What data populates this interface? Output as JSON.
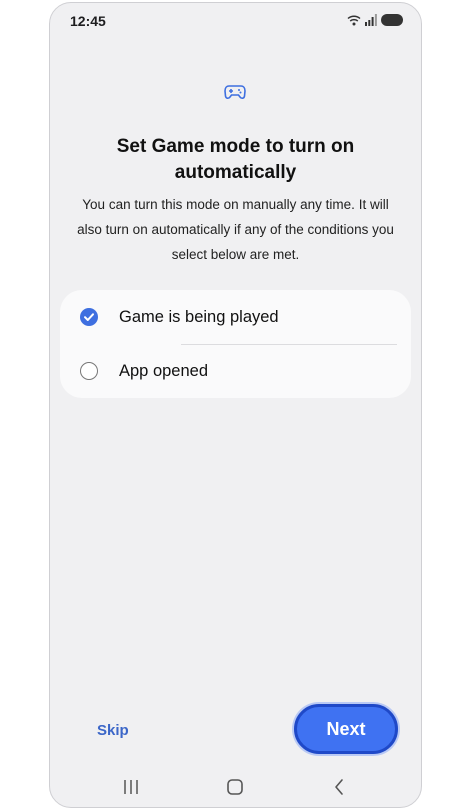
{
  "status_bar": {
    "time": "12:45"
  },
  "icons": {
    "game": "gamepad-icon",
    "wifi": "wifi-icon",
    "signal": "signal-icon",
    "battery": "battery-icon"
  },
  "header": {
    "title": "Set Game mode to turn on automatically",
    "description": "You can turn this mode on manually any time. It will also turn on automatically if any of the conditions you select below are met."
  },
  "options": [
    {
      "label": "Game is being played",
      "checked": true
    },
    {
      "label": "App opened",
      "checked": false
    }
  ],
  "footer": {
    "skip_label": "Skip",
    "next_label": "Next"
  },
  "colors": {
    "accent": "#3e6fe0",
    "next_button": "#3f72f2",
    "background": "#f0f0f2",
    "card": "#fafafb"
  }
}
